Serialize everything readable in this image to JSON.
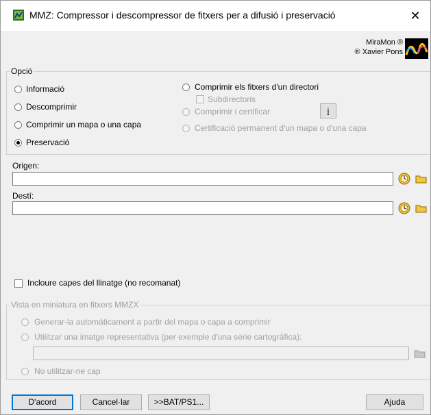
{
  "window": {
    "title": "MMZ: Compressor i descompressor de fitxers per a difusió i preservació",
    "close_glyph": "✕"
  },
  "brand": {
    "line1": "MiraMon ®",
    "line2": "® Xavier Pons"
  },
  "option_group": {
    "legend": "Opció",
    "options": [
      {
        "label": "Informació",
        "checked": false
      },
      {
        "label": "Descomprimir",
        "checked": false
      },
      {
        "label": "Comprimir un mapa o una capa",
        "checked": false
      },
      {
        "label": "Preservació",
        "checked": true
      },
      {
        "label": "Comprimir els fitxers d'un directori",
        "checked": false
      },
      {
        "label": "Comprimir i certificar",
        "checked": false,
        "disabled": true
      },
      {
        "label": "Certificació permanent d'un mapa o d'una capa",
        "checked": false,
        "disabled": true
      }
    ],
    "subdirectoris_label": "Subdirectoris",
    "info_button": "i"
  },
  "origin": {
    "label": "Origen:",
    "value": ""
  },
  "destination": {
    "label": "Destí:",
    "value": ""
  },
  "lineage_checkbox": {
    "label": "Incloure capes del llinatge (no recomanat)",
    "checked": false
  },
  "thumbnail_group": {
    "legend": "Vista en miniatura en fitxers MMZX",
    "options": [
      {
        "label": "Generar-la automàticament a partir del mapa o capa a comprimir"
      },
      {
        "label": "Utilitzar una imatge representativa (per exemple d'una sèrie cartogràfica):"
      },
      {
        "label": "No utilitzar-ne cap"
      }
    ]
  },
  "buttons": {
    "ok": "D'acord",
    "cancel": "Cancel·lar",
    "bat": ">>BAT/PS1...",
    "help": "Ajuda"
  },
  "colors": {
    "accent": "#0078d7",
    "folder": "#f4c542"
  }
}
